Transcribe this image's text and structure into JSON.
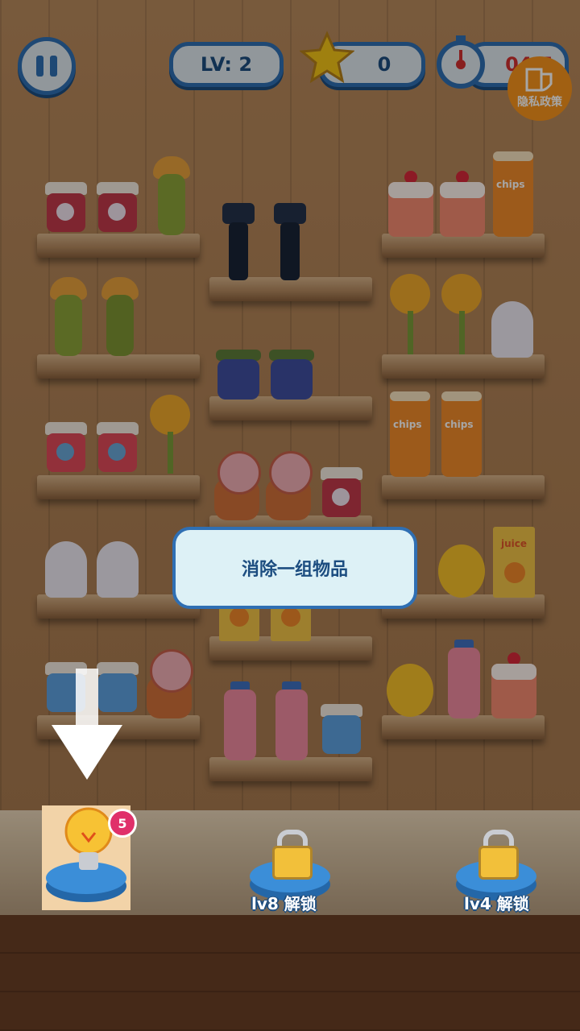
{
  "hud": {
    "level_text": "LV: 2",
    "score_value": "0",
    "timer_text": "04:5"
  },
  "privacy": {
    "label": "隐私政策"
  },
  "tooltip": {
    "text": "消除一组物品"
  },
  "powerups": {
    "hint_badge": "5",
    "slot2_label": "lv8 解锁",
    "slot3_label": "lv4 解锁"
  },
  "chips_label": "chips",
  "juice_label": "juice",
  "colors": {
    "frame_blue": "#2f6fb3",
    "star_yellow": "#f5c518",
    "privacy_orange": "#f7941d"
  }
}
